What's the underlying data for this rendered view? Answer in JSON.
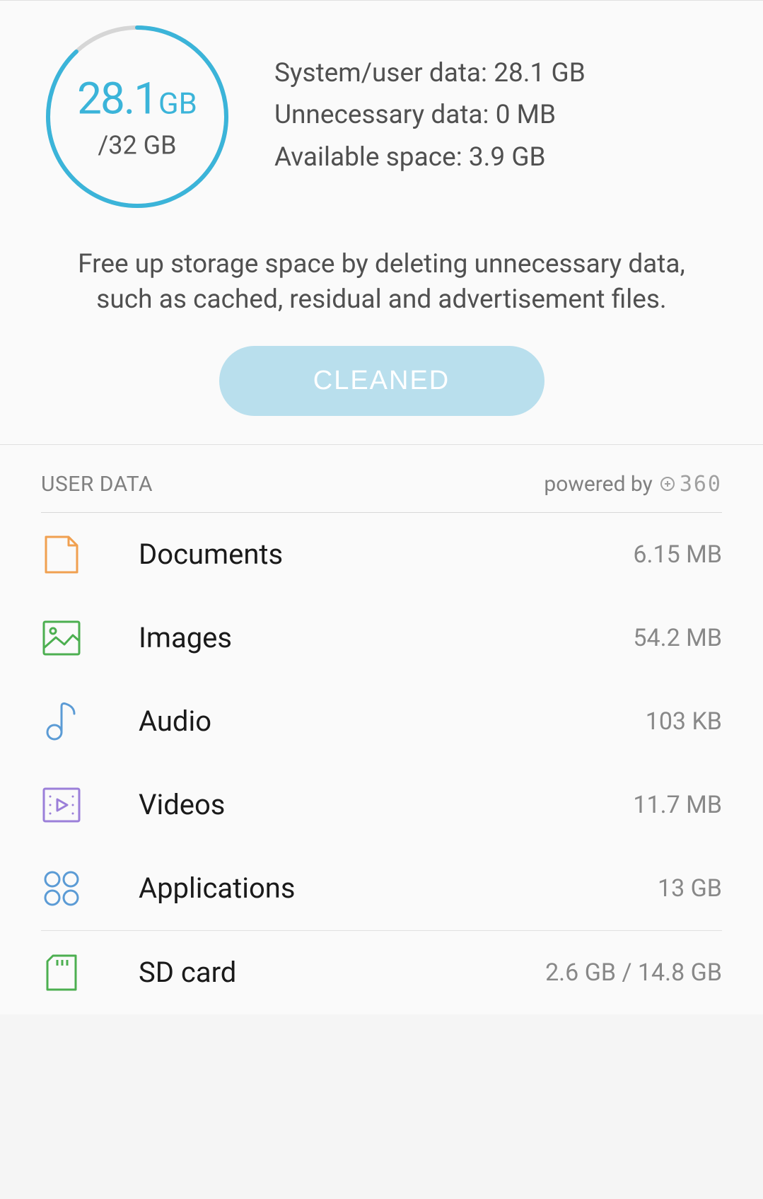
{
  "storage": {
    "used_value": "28.1",
    "used_unit": "GB",
    "total_text": "/32 GB",
    "percent": 88,
    "details": {
      "system_user": "System/user data: 28.1 GB",
      "unnecessary": "Unnecessary data: 0 MB",
      "available": "Available space: 3.9 GB"
    }
  },
  "description": "Free up storage space by deleting unnecessary data, such as cached, residual and advertisement files.",
  "clean_button_label": "CLEANED",
  "section": {
    "title": "USER DATA",
    "powered_by": "powered by",
    "brand": "360"
  },
  "items": [
    {
      "label": "Documents",
      "size": "6.15 MB"
    },
    {
      "label": "Images",
      "size": "54.2 MB"
    },
    {
      "label": "Audio",
      "size": "103 KB"
    },
    {
      "label": "Videos",
      "size": "11.7 MB"
    },
    {
      "label": "Applications",
      "size": "13 GB"
    },
    {
      "label": "SD card",
      "size": "2.6 GB / 14.8 GB"
    }
  ]
}
